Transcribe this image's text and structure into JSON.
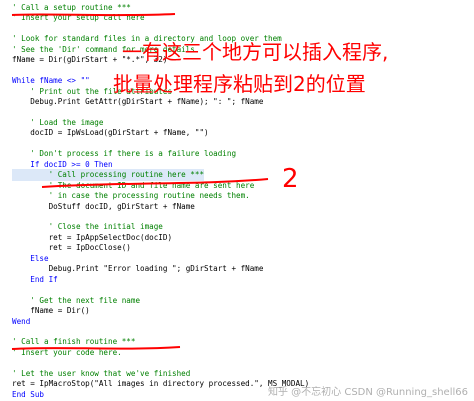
{
  "code": {
    "lines": [
      {
        "text": "' Call a setup routine ***",
        "kind": "comment"
      },
      {
        "text": "' Insert your setup call here",
        "kind": "comment"
      },
      {
        "text": "",
        "kind": "text"
      },
      {
        "text": "' Look for standard files in a directory and loop over them",
        "kind": "comment"
      },
      {
        "text": "' See the 'Dir' command for more details",
        "kind": "comment"
      },
      {
        "text": "fName = Dir(gDirStart + \"*.*\", 32)",
        "kind": "text"
      },
      {
        "text": "",
        "kind": "text"
      },
      {
        "text": "While fName <> \"\"",
        "kind": "keyword"
      },
      {
        "text": "    ' Print out the file attributes",
        "kind": "comment"
      },
      {
        "text": "    Debug.Print GetAttr(gDirStart + fName); \": \"; fName",
        "kind": "text"
      },
      {
        "text": "",
        "kind": "text"
      },
      {
        "text": "    ' Load the image",
        "kind": "comment"
      },
      {
        "text": "    docID = IpWsLoad(gDirStart + fName, \"\")",
        "kind": "text"
      },
      {
        "text": "",
        "kind": "text"
      },
      {
        "text": "    ' Don't process if there is a failure loading",
        "kind": "comment"
      },
      {
        "text": "    If docID >= 0 Then",
        "kind": "keyword"
      },
      {
        "text": "        ' Call processing routine here ***",
        "kind": "comment",
        "highlight": true
      },
      {
        "text": "        ' The document ID and file name are sent here",
        "kind": "comment"
      },
      {
        "text": "        ' in case the processing routine needs them.",
        "kind": "comment"
      },
      {
        "text": "        DoStuff docID, gDirStart + fName",
        "kind": "text"
      },
      {
        "text": "",
        "kind": "text"
      },
      {
        "text": "        ' Close the initial image",
        "kind": "comment"
      },
      {
        "text": "        ret = IpAppSelectDoc(docID)",
        "kind": "text"
      },
      {
        "text": "        ret = IpDocClose()",
        "kind": "text"
      },
      {
        "text": "    Else",
        "kind": "keyword"
      },
      {
        "text": "        Debug.Print \"Error loading \"; gDirStart + fName",
        "kind": "text"
      },
      {
        "text": "    End If",
        "kind": "keyword"
      },
      {
        "text": "",
        "kind": "text"
      },
      {
        "text": "    ' Get the next file name",
        "kind": "comment"
      },
      {
        "text": "    fName = Dir()",
        "kind": "text"
      },
      {
        "text": "Wend",
        "kind": "keyword"
      },
      {
        "text": "",
        "kind": "text"
      },
      {
        "text": "' Call a finish routine ***",
        "kind": "comment"
      },
      {
        "text": "' Insert your code here.",
        "kind": "comment"
      },
      {
        "text": "",
        "kind": "text"
      },
      {
        "text": "' Let the user know that we've finished",
        "kind": "comment"
      },
      {
        "text": "ret = IpMacroStop(\"All images in directory processed.\", MS_MODAL)",
        "kind": "text"
      },
      {
        "text": "End Sub",
        "kind": "keyword"
      }
    ]
  },
  "annotations": {
    "line1": "一有这三个地方可以插入程序,",
    "line2": "批量处理程序粘贴到2的位置",
    "marker": "2",
    "color": "#ff0000"
  },
  "watermark": "知乎 @不忘初心 CSDN @Running_shell66"
}
